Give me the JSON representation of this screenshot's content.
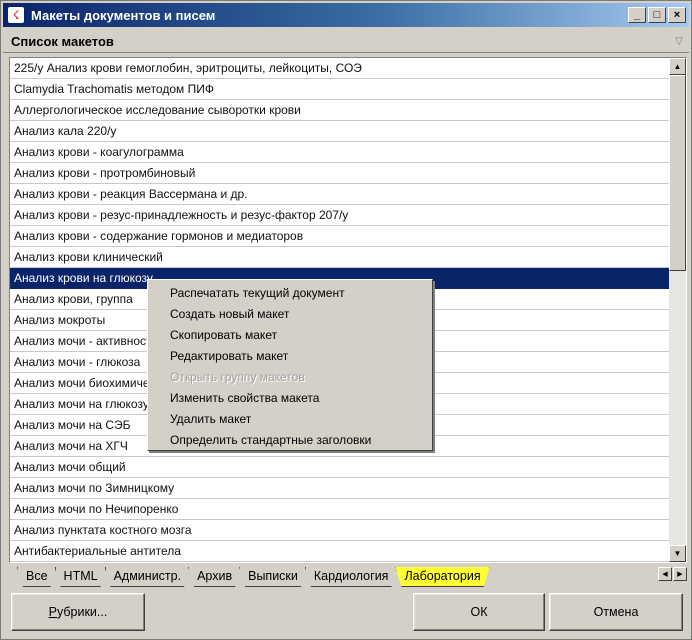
{
  "window": {
    "title": "Макеты документов и писем",
    "minimize": "_",
    "restore": "□",
    "close": "×"
  },
  "list": {
    "header": "Список макетов",
    "rows": [
      "225/у Анализ крови гемоглобин, эритроциты, лейкоциты, СОЭ",
      "Clamydia Trachomatis методом ПИФ",
      "Аллергологическое исследование сыворотки крови",
      "Анализ кала 220/у",
      "Анализ крови - коагулограмма",
      "Анализ крови - протромбиновый",
      "Анализ крови - реакция Вассермана и др.",
      "Анализ крови - резус-принадлежность и резус-фактор 207/у",
      "Анализ крови - содержание гормонов и медиаторов",
      "Анализ крови клинический",
      "Анализ крови на глюкозу",
      "Анализ крови, группа",
      "Анализ мокроты",
      "Анализ мочи - активность",
      "Анализ мочи - глюкоза",
      "Анализ мочи биохимический",
      "Анализ мочи на глюкозу",
      "Анализ мочи на СЭБ",
      "Анализ мочи на ХГЧ",
      "Анализ мочи общий",
      "Анализ мочи по Зимницкому",
      "Анализ мочи по Нечипоренко",
      "Анализ пунктата костного мозга",
      "Антибактериальные антитела"
    ],
    "selected_index": 10
  },
  "context_menu": {
    "items": [
      {
        "label": "Распечатать текущий документ",
        "disabled": false
      },
      {
        "label": "Создать новый макет",
        "disabled": false
      },
      {
        "label": "Скопировать макет",
        "disabled": false
      },
      {
        "label": "Редактировать макет",
        "disabled": false
      },
      {
        "label": "Открыть группу макетов",
        "disabled": true
      },
      {
        "label": "Изменить свойства макета",
        "disabled": false
      },
      {
        "label": "Удалить макет",
        "disabled": false
      },
      {
        "label": "Определить стандартные заголовки",
        "disabled": false
      }
    ]
  },
  "tabs": {
    "items": [
      "Все",
      "HTML",
      "Администр.",
      "Архив",
      "Выписки",
      "Кардиология",
      "Лаборатория"
    ],
    "active_index": 6,
    "active_color": "#ffff33"
  },
  "buttons": {
    "rubrics": "Рубрики...",
    "ok": "ОК",
    "cancel": "Отмена"
  },
  "colors": {
    "selection": "#0a246a",
    "face": "#d4d0c8"
  }
}
